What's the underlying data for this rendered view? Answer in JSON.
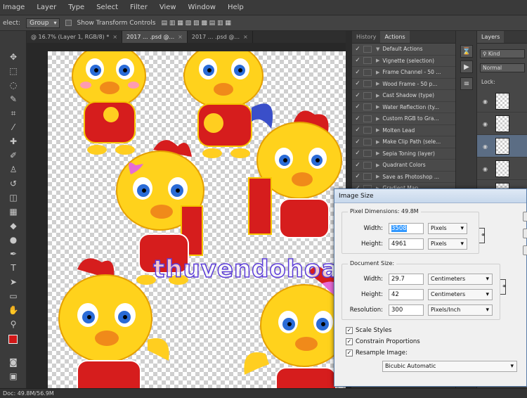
{
  "menu": [
    "Image",
    "Layer",
    "Type",
    "Select",
    "Filter",
    "View",
    "Window",
    "Help"
  ],
  "options_bar": {
    "select_label": "elect:",
    "select_value": "Group",
    "transform_label": "Show Transform Controls"
  },
  "tabs": [
    {
      "label": "@ 16.7% (Layer 1, RGB/8) *",
      "active": false
    },
    {
      "label": "2017 ... .psd @...",
      "active": true
    },
    {
      "label": "2017 ... .psd @...",
      "active": false
    }
  ],
  "status": {
    "doc": "Doc: 49.8M/56.9M"
  },
  "watermark": "thuvendohoa.com.vn",
  "actions_panel": {
    "tabs": [
      "History",
      "Actions"
    ],
    "items": [
      "Default Actions",
      "Vignette (selection)",
      "Frame Channel - 50 ...",
      "Wood Frame - 50 p...",
      "Cast Shadow (type)",
      "Water Reflection (ty...",
      "Custom RGB to Gra...",
      "Molten Lead",
      "Make Clip Path (sele...",
      "Sepia Toning (layer)",
      "Quadrant Colors",
      "Save as Photoshop ...",
      "Gradient Map"
    ]
  },
  "layers_panel": {
    "tab": "Layers",
    "kind": "Kind",
    "blend": "Normal",
    "lock": "Lock:"
  },
  "dialog": {
    "title": "Image Size",
    "pixel_dimensions_label": "Pixel Dimensions: 49.8M",
    "width_label": "Width:",
    "width_value": "3508",
    "width_unit": "Pixels",
    "height_label": "Height:",
    "height_value": "4961",
    "height_unit": "Pixels",
    "doc_size_label": "Document Size:",
    "doc_width_label": "Width:",
    "doc_width_value": "29.7",
    "doc_width_unit": "Centimeters",
    "doc_height_label": "Height:",
    "doc_height_value": "42",
    "doc_height_unit": "Centimeters",
    "resolution_label": "Resolution:",
    "resolution_value": "300",
    "resolution_unit": "Pixels/Inch",
    "scale_styles": "Scale Styles",
    "constrain": "Constrain Proportions",
    "resample": "Resample Image:",
    "resample_method": "Bicubic Automatic"
  }
}
